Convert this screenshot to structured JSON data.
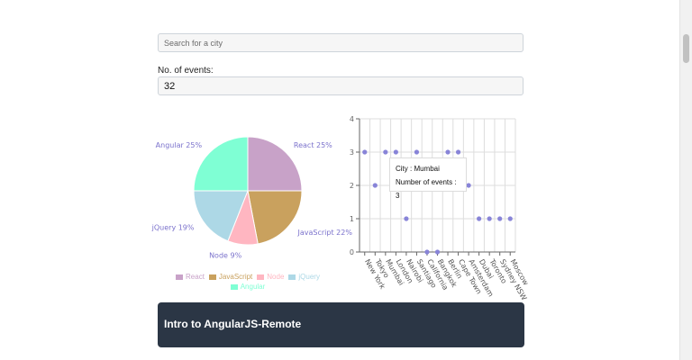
{
  "search": {
    "placeholder": "Search for a city"
  },
  "events": {
    "label": "No. of events:",
    "value": "32"
  },
  "pie": {
    "slices": [
      {
        "label": "React",
        "percent": 25,
        "color": "#c8a2c8"
      },
      {
        "label": "JavaScript",
        "percent": 22,
        "color": "#c9a15e"
      },
      {
        "label": "Node",
        "percent": 9,
        "color": "#ffb6c1"
      },
      {
        "label": "jQuery",
        "percent": 19,
        "color": "#add8e6"
      },
      {
        "label": "Angular",
        "percent": 25,
        "color": "#7fffd4"
      }
    ],
    "label_color": "#7b72cc"
  },
  "scatter": {
    "points": [
      {
        "city": "New York",
        "events": 3
      },
      {
        "city": "Tokyo",
        "events": 2
      },
      {
        "city": "Mumbai",
        "events": 3
      },
      {
        "city": "London",
        "events": 3
      },
      {
        "city": "Nairobi",
        "events": 1
      },
      {
        "city": "Santiago",
        "events": 3
      },
      {
        "city": "California",
        "events": 0
      },
      {
        "city": "Bangkok",
        "events": 0
      },
      {
        "city": "Berlin",
        "events": 3
      },
      {
        "city": "Cape Town",
        "events": 3
      },
      {
        "city": "Amsterdam",
        "events": 2
      },
      {
        "city": "Dubai",
        "events": 1
      },
      {
        "city": "Toronto",
        "events": 1
      },
      {
        "city": "Sydney NSW",
        "events": 1
      },
      {
        "city": "Moscow",
        "events": 1
      }
    ],
    "y_ticks": [
      "0",
      "1",
      "2",
      "3",
      "4"
    ],
    "ylim": [
      0,
      4
    ],
    "point_color": "#8884d8"
  },
  "tooltip": {
    "city_line": "City : Mumbai",
    "events_line": "Number of events : 3"
  },
  "banner": {
    "title": "Intro to AngularJS-Remote"
  }
}
